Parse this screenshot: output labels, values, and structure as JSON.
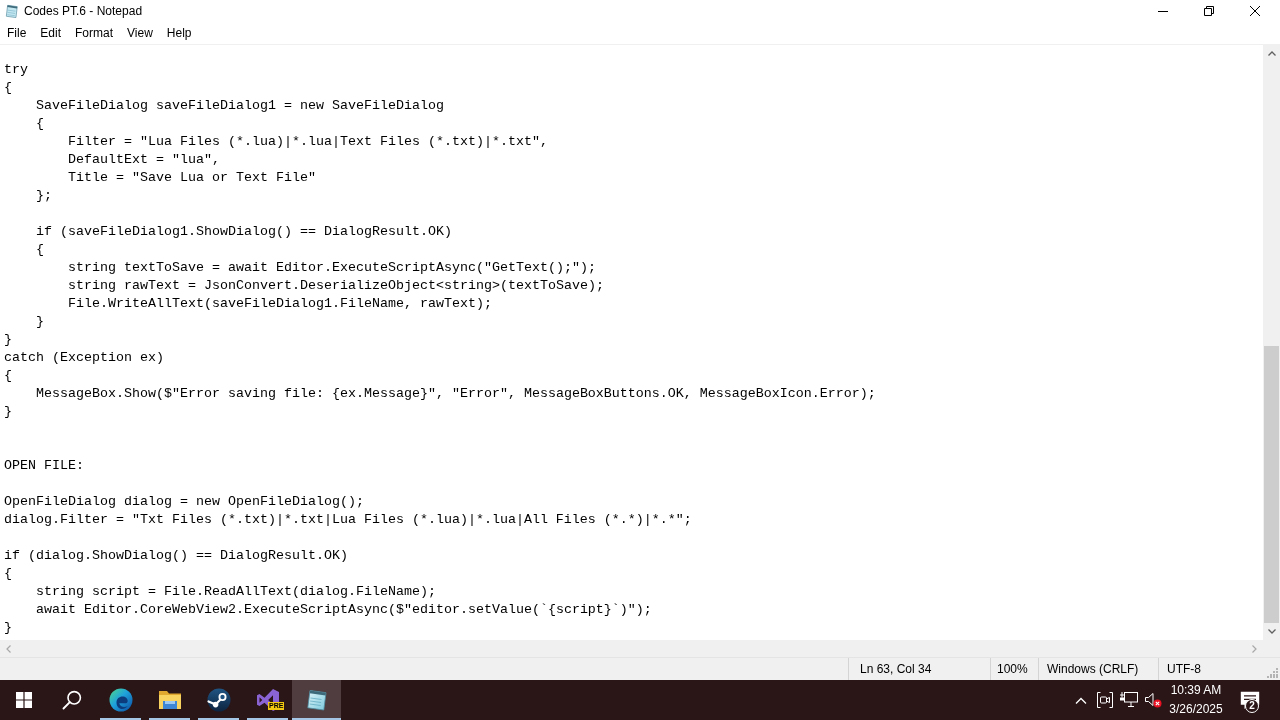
{
  "window": {
    "title": "Codes PT.6 - Notepad",
    "maximized": true
  },
  "menu": [
    {
      "label": "File"
    },
    {
      "label": "Edit"
    },
    {
      "label": "Format"
    },
    {
      "label": "View"
    },
    {
      "label": "Help"
    }
  ],
  "editor": {
    "text": "try\n{\n    SaveFileDialog saveFileDialog1 = new SaveFileDialog\n    {\n        Filter = \"Lua Files (*.lua)|*.lua|Text Files (*.txt)|*.txt\",\n        DefaultExt = \"lua\",\n        Title = \"Save Lua or Text File\"\n    };\n\n    if (saveFileDialog1.ShowDialog() == DialogResult.OK)\n    {\n        string textToSave = await Editor.ExecuteScriptAsync(\"GetText();\");\n        string rawText = JsonConvert.DeserializeObject<string>(textToSave);\n        File.WriteAllText(saveFileDialog1.FileName, rawText);\n    }\n}\ncatch (Exception ex)\n{\n    MessageBox.Show($\"Error saving file: {ex.Message}\", \"Error\", MessageBoxButtons.OK, MessageBoxIcon.Error);\n}\n\n\nOPEN FILE:\n\nOpenFileDialog dialog = new OpenFileDialog();\ndialog.Filter = \"Txt Files (*.txt)|*.txt|Lua Files (*.lua)|*.lua|All Files (*.*)|*.*\";\n\nif (dialog.ShowDialog() == DialogResult.OK)\n{\n    string script = File.ReadAllText(dialog.FileName);\n    await Editor.CoreWebView2.ExecuteScriptAsync($\"editor.setValue(`{script}`)\");\n}"
  },
  "status_bar": {
    "position": "Ln 63, Col 34",
    "zoom": "100%",
    "line_ending": "Windows (CRLF)",
    "encoding": "UTF-8"
  },
  "taskbar": {
    "apps": [
      {
        "kind": "browser",
        "running": true,
        "selected": false
      },
      {
        "kind": "folder",
        "running": true,
        "selected": false
      },
      {
        "kind": "game",
        "running": true,
        "selected": false
      },
      {
        "kind": "ide",
        "badge": "PRE",
        "running": true,
        "selected": false
      },
      {
        "kind": "notepad",
        "running": true,
        "selected": true
      }
    ],
    "tray": {
      "muted": true
    },
    "clock": {
      "time": "10:39 AM",
      "date": "3/26/2025"
    },
    "notifications": "2"
  }
}
